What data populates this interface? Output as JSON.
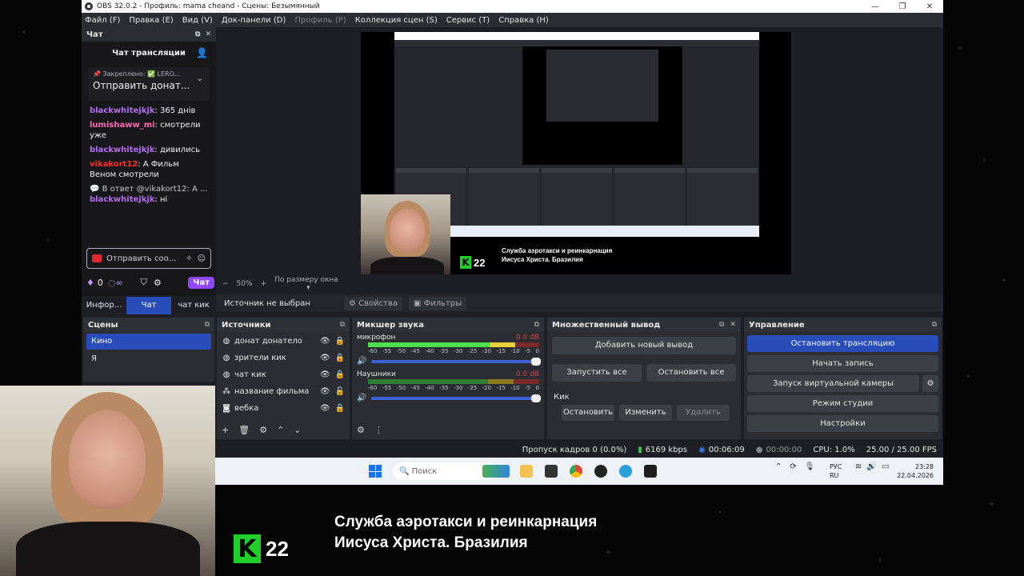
{
  "window": {
    "title": "OBS 32.0.2 - Профиль: mama cheand - Сцены: Безымянный",
    "controls": [
      "—",
      "❐",
      "✕"
    ]
  },
  "menu": [
    "Файл (F)",
    "Правка (E)",
    "Вид (V)",
    "Док-панели (D)",
    "Профиль (P)",
    "Коллекция сцен (S)",
    "Сервис (T)",
    "Справка (H)"
  ],
  "chat": {
    "dock_title": "Чат",
    "header": "Чат трансляции",
    "pinned_label": "Закреплено: ✅ LERO...",
    "pinned_text": "Отправить донат...",
    "messages": [
      {
        "user": "blackwhitejkjk",
        "color": "purple",
        "text": ": 365 днів"
      },
      {
        "user": "lumishaww_mi",
        "color": "pink",
        "text": ": смотрели уже"
      },
      {
        "user": "blackwhitejkjk",
        "color": "purple",
        "text": ": дивились"
      },
      {
        "user": "vikakort12",
        "color": "red",
        "text": ": А Фильм Веном смотрели"
      }
    ],
    "reply_line": "В ответ @vikakort12: А ...",
    "last_user": "blackwhitejkjk",
    "last_text": ": ні",
    "input_placeholder": "Отправить соо...",
    "points": "0",
    "chat_button": "Чат"
  },
  "dock_tabs": [
    "Инфор...",
    "Чат",
    "чат кик"
  ],
  "preview": {
    "zoom_minus": "−",
    "zoom_value": "50%",
    "zoom_plus": "+",
    "fit_label": "По размеру окна",
    "caption_line1": "Служба аэротакси и реинкарнация",
    "caption_line2": "Иисуса Христа. Бразилия",
    "k22_num": "22",
    "k22_letter": "K"
  },
  "source_bar": {
    "no_source": "Источник не выбран",
    "properties": "Свойства",
    "filters": "Фильтры"
  },
  "scenes": {
    "title": "Сцены",
    "items": [
      "Кино",
      "Я"
    ]
  },
  "sources": {
    "title": "Источники",
    "items": [
      {
        "name": "донат донатело",
        "icon": "globe-icon"
      },
      {
        "name": "зрители кик",
        "icon": "globe-icon"
      },
      {
        "name": "чат кик",
        "icon": "globe-icon"
      },
      {
        "name": "название фильма",
        "icon": "group-icon"
      },
      {
        "name": "вебка",
        "icon": "camera-icon"
      }
    ]
  },
  "mixer": {
    "title": "Микшер звука",
    "ticks": [
      "-60",
      "-55",
      "-50",
      "-45",
      "-40",
      "-35",
      "-30",
      "-25",
      "-20",
      "-15",
      "-10",
      "-5",
      "0"
    ],
    "channels": [
      {
        "name": "микрофон",
        "db": "0.0 dB",
        "level": 0.86
      },
      {
        "name": "Наушники",
        "db": "0.0 dB",
        "level": 0.0
      }
    ]
  },
  "multi_output": {
    "title": "Множественный вывод",
    "add_button": "Добавить новый вывод",
    "start_all": "Запустить все",
    "stop_all": "Остановить все",
    "target_name": "Кик",
    "stop": "Остановить",
    "edit": "Изменить",
    "delete": "Удалить"
  },
  "controls": {
    "title": "Управление",
    "stop_stream": "Остановить трансляцию",
    "start_record": "Начать запись",
    "virtual_cam": "Запуск виртуальной камеры",
    "studio_mode": "Режим студии",
    "settings": "Настройки"
  },
  "status": {
    "dropped": "Пропуск кадров 0 (0.0%)",
    "bitrate": "6169 kbps",
    "stream_time": "00:06:09",
    "rec_time": "00:00:00",
    "cpu": "CPU: 1.0%",
    "fps": "25.00 / 25.00 FPS"
  },
  "taskbar": {
    "search": "Поиск",
    "lang1": "РУС",
    "lang2": "RU",
    "time": "23:28",
    "date": "22.04.2026"
  },
  "overlay": {
    "line1": "Служба аэротакси и реинкарнация",
    "line2": "Иисуса Христа. Бразилия",
    "k22_num": "22",
    "k22_letter": "K"
  },
  "colors": {
    "accent": "#284cb8",
    "twitch_purple": "#9147ff",
    "k22_green": "#1fd02b"
  }
}
